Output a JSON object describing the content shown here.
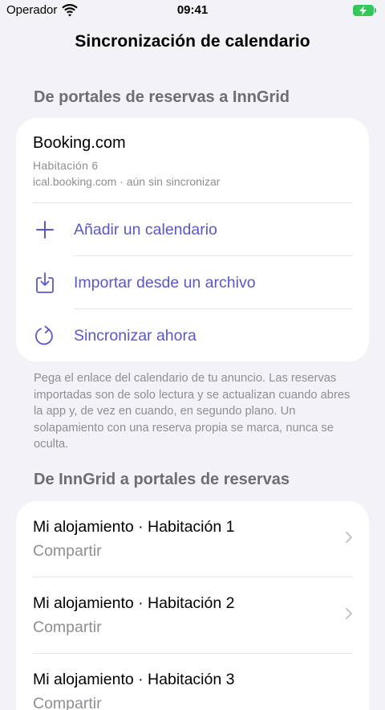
{
  "status": {
    "carrier": "Operador",
    "time": "09:41"
  },
  "nav": {
    "title": "Sincronización de calendario"
  },
  "import_section": {
    "header": "De portales de reservas a InnGrid",
    "listing": {
      "name": "Booking.com",
      "room": "Habitación 6",
      "source": "ical.booking.com · aún sin sincronizar"
    },
    "actions": [
      {
        "label": "Añadir un calendario",
        "icon": "plus-icon"
      },
      {
        "label": "Importar desde un archivo",
        "icon": "import-file-icon"
      },
      {
        "label": "Sincronizar ahora",
        "icon": "refresh-icon"
      }
    ],
    "footer": "Pega el enlace del calendario de tu anuncio. Las reservas importadas son de solo lectura y se actualizan cuando abres la app y, de vez en cuando, en segundo plano. Un solapamiento con una reserva propia se marca, nunca se oculta."
  },
  "export_section": {
    "header": "De InnGrid a portales de reservas",
    "rows": [
      {
        "title": "Mi alojamiento · Habitación 1",
        "subtitle": "Compartir"
      },
      {
        "title": "Mi alojamiento · Habitación 2",
        "subtitle": "Compartir"
      },
      {
        "title": "Mi alojamiento · Habitación 3",
        "subtitle": "Compartir"
      }
    ]
  },
  "colors": {
    "accent": "#5b57c9",
    "battery": "#34c759",
    "background": "#f2f2f7"
  }
}
